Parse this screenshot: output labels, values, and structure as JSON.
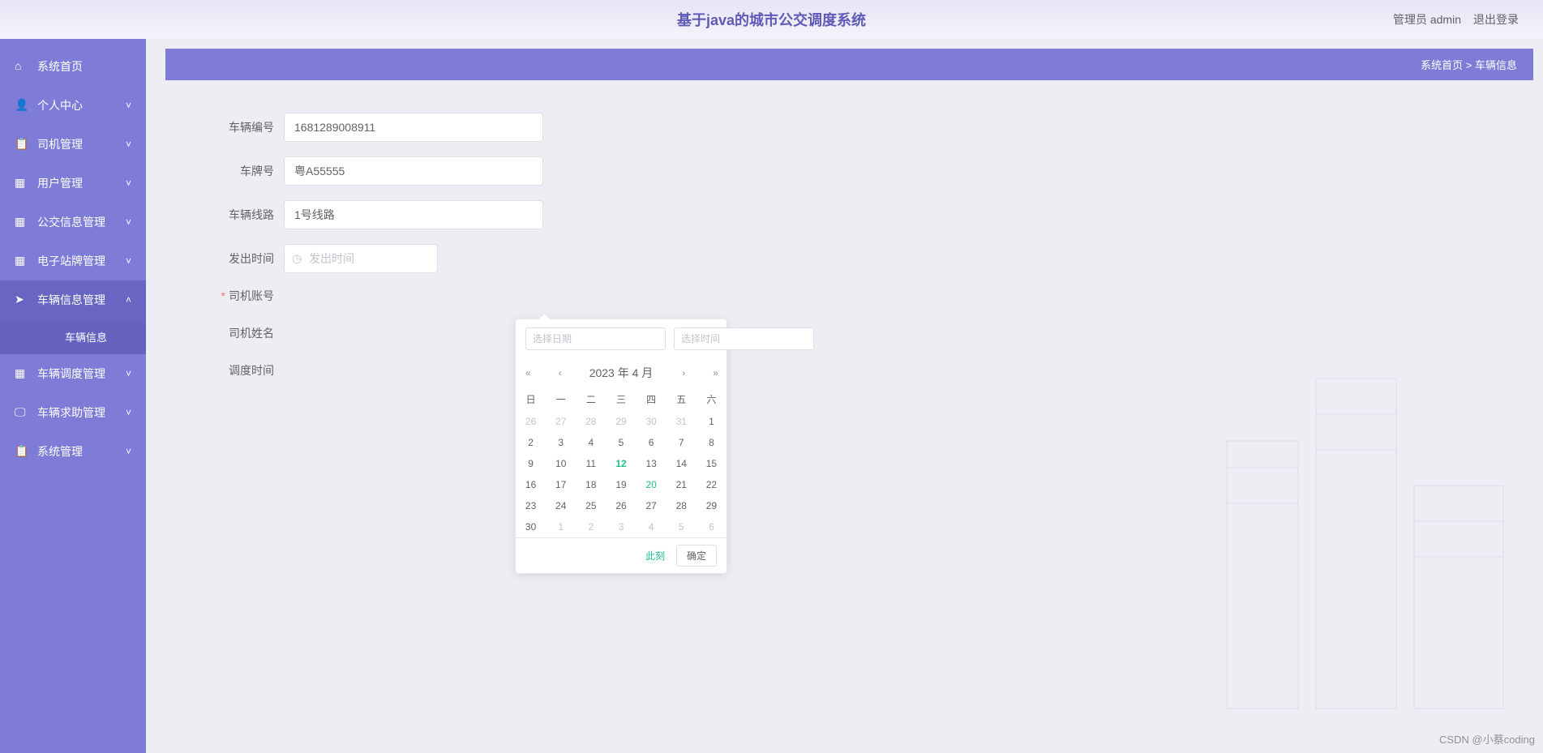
{
  "header": {
    "title": "基于java的城市公交调度系统",
    "user_label": "管理员 admin",
    "logout": "退出登录"
  },
  "sidebar": {
    "items": [
      {
        "icon": "home",
        "label": "系统首页",
        "expandable": false
      },
      {
        "icon": "person",
        "label": "个人中心",
        "expandable": true
      },
      {
        "icon": "clipboard",
        "label": "司机管理",
        "expandable": true
      },
      {
        "icon": "grid",
        "label": "用户管理",
        "expandable": true
      },
      {
        "icon": "grid",
        "label": "公交信息管理",
        "expandable": true
      },
      {
        "icon": "grid",
        "label": "电子站牌管理",
        "expandable": true
      },
      {
        "icon": "send",
        "label": "车辆信息管理",
        "expandable": true,
        "expanded": true,
        "children": [
          {
            "label": "车辆信息"
          }
        ]
      },
      {
        "icon": "grid",
        "label": "车辆调度管理",
        "expandable": true
      },
      {
        "icon": "monitor",
        "label": "车辆求助管理",
        "expandable": true
      },
      {
        "icon": "clipboard",
        "label": "系统管理",
        "expandable": true
      }
    ]
  },
  "breadcrumb": {
    "home": "系统首页",
    "sep": ">",
    "current": "车辆信息"
  },
  "form": {
    "vehicle_id": {
      "label": "车辆编号",
      "value": "1681289008911"
    },
    "plate": {
      "label": "车牌号",
      "value": "粤A55555"
    },
    "route": {
      "label": "车辆线路",
      "value": "1号线路"
    },
    "depart_time": {
      "label": "发出时间",
      "placeholder": "发出时间"
    },
    "driver_account": {
      "label": "司机账号"
    },
    "driver_name": {
      "label": "司机姓名"
    },
    "dispatch_time": {
      "label": "调度时间"
    }
  },
  "datepicker": {
    "date_placeholder": "选择日期",
    "time_placeholder": "选择时间",
    "year_month": "2023 年  4 月",
    "weekdays": [
      "日",
      "一",
      "二",
      "三",
      "四",
      "五",
      "六"
    ],
    "weeks": [
      [
        {
          "d": "26",
          "o": true
        },
        {
          "d": "27",
          "o": true
        },
        {
          "d": "28",
          "o": true
        },
        {
          "d": "29",
          "o": true
        },
        {
          "d": "30",
          "o": true
        },
        {
          "d": "31",
          "o": true
        },
        {
          "d": "1"
        }
      ],
      [
        {
          "d": "2"
        },
        {
          "d": "3"
        },
        {
          "d": "4"
        },
        {
          "d": "5"
        },
        {
          "d": "6"
        },
        {
          "d": "7"
        },
        {
          "d": "8"
        }
      ],
      [
        {
          "d": "9"
        },
        {
          "d": "10"
        },
        {
          "d": "11"
        },
        {
          "d": "12",
          "today": true
        },
        {
          "d": "13"
        },
        {
          "d": "14"
        },
        {
          "d": "15"
        }
      ],
      [
        {
          "d": "16"
        },
        {
          "d": "17"
        },
        {
          "d": "18"
        },
        {
          "d": "19"
        },
        {
          "d": "20",
          "hover": true
        },
        {
          "d": "21"
        },
        {
          "d": "22"
        }
      ],
      [
        {
          "d": "23"
        },
        {
          "d": "24"
        },
        {
          "d": "25"
        },
        {
          "d": "26"
        },
        {
          "d": "27"
        },
        {
          "d": "28"
        },
        {
          "d": "29"
        }
      ],
      [
        {
          "d": "30"
        },
        {
          "d": "1",
          "o": true
        },
        {
          "d": "2",
          "o": true
        },
        {
          "d": "3",
          "o": true
        },
        {
          "d": "4",
          "o": true
        },
        {
          "d": "5",
          "o": true
        },
        {
          "d": "6",
          "o": true
        }
      ]
    ],
    "now": "此刻",
    "ok": "确定"
  },
  "watermark": "CSDN @小蔡coding"
}
